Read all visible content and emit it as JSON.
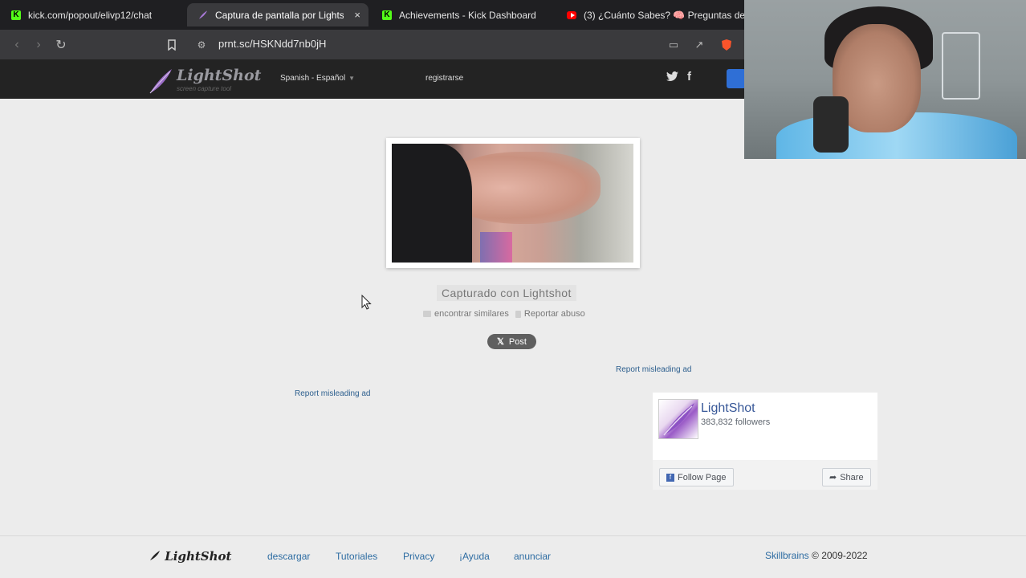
{
  "browser": {
    "tabs": [
      {
        "label": "kick.com/popout/elivp12/chat",
        "icon": "kick-icon"
      },
      {
        "label": "Captura de pantalla por Lightshot",
        "icon": "lightshot-feather-icon",
        "active": true,
        "close": "×"
      },
      {
        "label": "Achievements - Kick Dashboard",
        "icon": "kick-icon"
      },
      {
        "label": "(3) ¿Cuánto Sabes? 🧠 Preguntas de",
        "icon": "youtube-icon"
      }
    ],
    "url": "prnt.sc/HSKNdd7nb0jH"
  },
  "header": {
    "logo": "LightShot",
    "logo_sub": "screen capture tool",
    "language": "Spanish - Español",
    "register": "registrarse"
  },
  "main": {
    "caption": "Capturado con Lightshot",
    "find_similar": "encontrar similares",
    "report_abuse": "Reportar abuso",
    "x_post": "Post",
    "report_ad_1": "Report misleading ad",
    "report_ad_2": "Report misleading ad"
  },
  "fb_widget": {
    "name": "LightShot",
    "followers": "383,832 followers",
    "follow": "Follow Page",
    "share": "Share"
  },
  "footer": {
    "logo": "LightShot",
    "links": [
      "descargar",
      "Tutoriales",
      "Privacy",
      "¡Ayuda",
      "anunciar"
    ],
    "company": "Skillbrains",
    "copyright": "© 2009-2022"
  },
  "colors": {
    "accent_kick": "#53fc18",
    "link_blue": "#2d6ca2",
    "header_bg": "#232323"
  }
}
